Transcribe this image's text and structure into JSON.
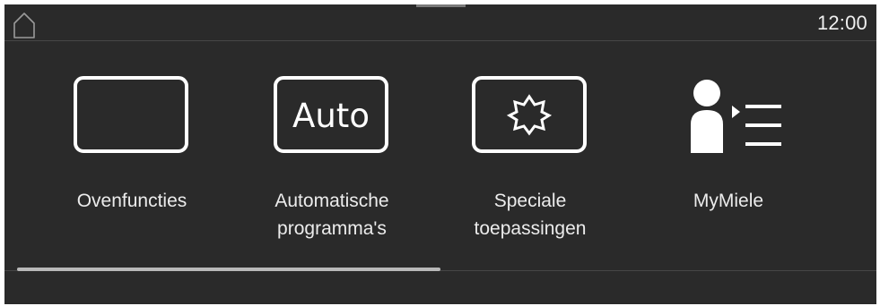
{
  "header": {
    "home_icon": "home-icon",
    "time": "12:00"
  },
  "tiles": [
    {
      "icon": "oven-functions-icon",
      "label": "Ovenfuncties"
    },
    {
      "icon": "auto-icon",
      "icon_text": "Auto",
      "label": "Automatische\nprogramma's"
    },
    {
      "icon": "special-applications-icon",
      "label": "Speciale\ntoepassingen"
    },
    {
      "icon": "mymiele-icon",
      "label": "MyMiele"
    }
  ],
  "scroll": {
    "position_fraction": 0.0,
    "visible_fraction": 0.5
  },
  "colors": {
    "background": "#2a2a2a",
    "foreground": "#ffffff",
    "text": "#ececec",
    "scroll_thumb": "#b9b9b9"
  }
}
